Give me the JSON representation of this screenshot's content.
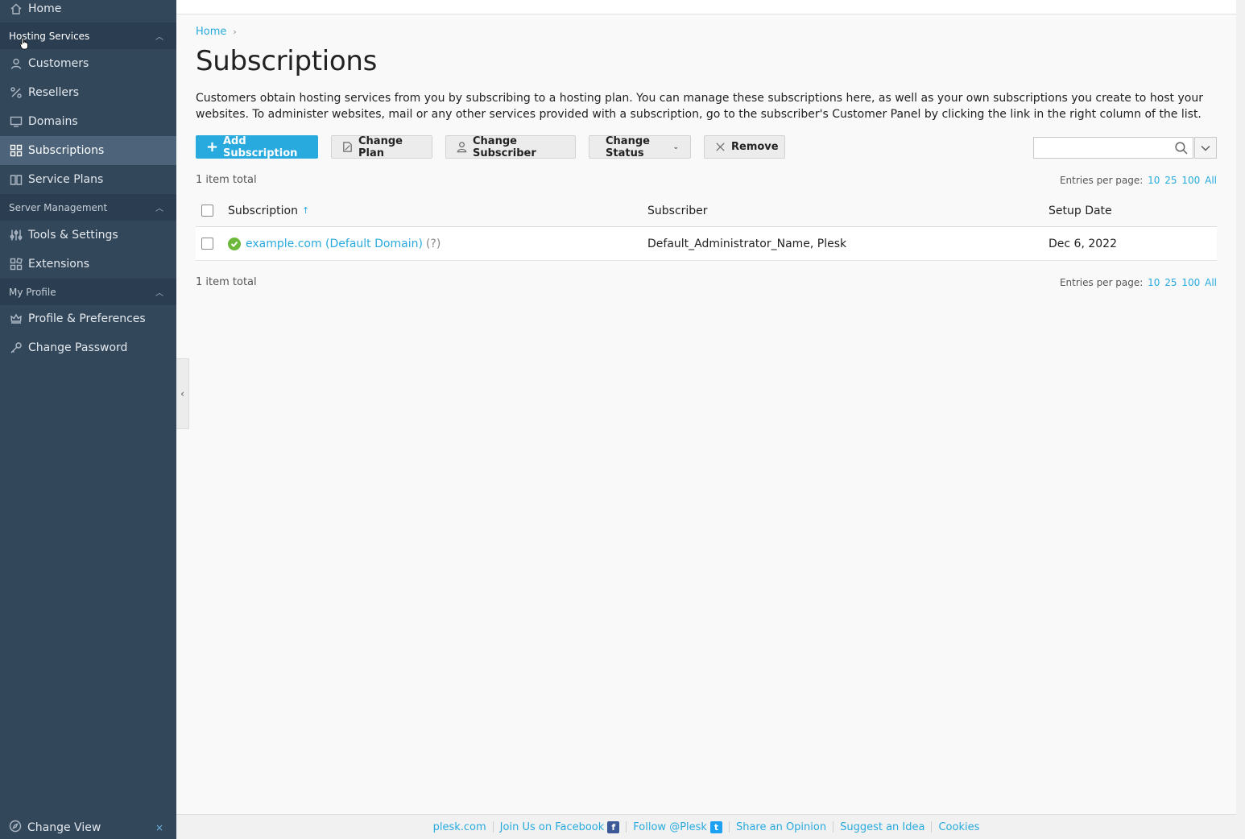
{
  "sidebar": {
    "home": "Home",
    "groups": {
      "hosting": "Hosting Services",
      "server": "Server Management",
      "profile": "My Profile"
    },
    "items": {
      "customers": "Customers",
      "resellers": "Resellers",
      "domains": "Domains",
      "subscriptions": "Subscriptions",
      "service_plans": "Service Plans",
      "tools": "Tools & Settings",
      "extensions": "Extensions",
      "preferences": "Profile & Preferences",
      "password": "Change Password"
    },
    "footer": {
      "change_view": "Change View",
      "close": "×"
    }
  },
  "breadcrumb": {
    "home": "Home",
    "sep": "›"
  },
  "page": {
    "title": "Subscriptions",
    "description": "Customers obtain hosting services from you by subscribing to a hosting plan. You can manage these subscriptions here, as well as your own subscriptions you create to host your websites. To administer websites, mail or any other services provided with a subscription, go to the subscriber's Customer Panel by clicking the link in the right column of the list."
  },
  "toolbar": {
    "add": "Add Subscription",
    "change_plan": "Change Plan",
    "change_subscriber": "Change Subscriber",
    "change_status": "Change Status",
    "remove": "Remove",
    "search_placeholder": ""
  },
  "list": {
    "total": "1 item total",
    "entries_label": "Entries per page:",
    "entries_options": [
      "10",
      "25",
      "100",
      "All"
    ],
    "columns": {
      "subscription": "Subscription",
      "subscriber": "Subscriber",
      "setup_date": "Setup Date"
    },
    "sort_arrow": "↑",
    "rows": [
      {
        "subscription": "example.com (Default Domain)",
        "help": "(?)",
        "subscriber": "Default_Administrator_Name, Plesk",
        "setup_date": "Dec 6, 2022"
      }
    ]
  },
  "footer": {
    "plesk": "plesk.com",
    "facebook": "Join Us on Facebook",
    "twitter": "Follow @Plesk",
    "opinion": "Share an Opinion",
    "idea": "Suggest an Idea",
    "cookies": "Cookies"
  },
  "colors": {
    "sidebar": "#33475b",
    "accent": "#28aade",
    "active": "#4d6379",
    "ok": "#6cb83a"
  }
}
